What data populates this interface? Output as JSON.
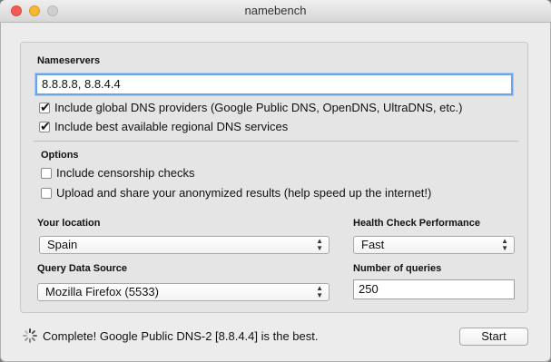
{
  "window": {
    "title": "namebench"
  },
  "nameservers": {
    "label": "Nameservers",
    "value": "8.8.8.8, 8.8.4.4",
    "checkboxes": [
      {
        "label": "Include global DNS providers (Google Public DNS, OpenDNS, UltraDNS, etc.)",
        "checked": true
      },
      {
        "label": "Include best available regional DNS services",
        "checked": true
      }
    ]
  },
  "options": {
    "label": "Options",
    "checkboxes": [
      {
        "label": "Include censorship checks",
        "checked": false
      },
      {
        "label": "Upload and share your anonymized results (help speed up the internet!)",
        "checked": false
      }
    ]
  },
  "location": {
    "label": "Your location",
    "value": "Spain"
  },
  "health_check": {
    "label": "Health Check Performance",
    "value": "Fast"
  },
  "query_source": {
    "label": "Query Data Source",
    "value": "Mozilla Firefox (5533)"
  },
  "queries": {
    "label": "Number of queries",
    "value": "250"
  },
  "status": {
    "text": "Complete! Google Public DNS-2 [8.8.4.4] is the best."
  },
  "start_button": {
    "label": "Start"
  },
  "colors": {
    "focus_ring": "#6aa5ea",
    "close": "#f45a52",
    "minimize": "#f6b82e"
  }
}
